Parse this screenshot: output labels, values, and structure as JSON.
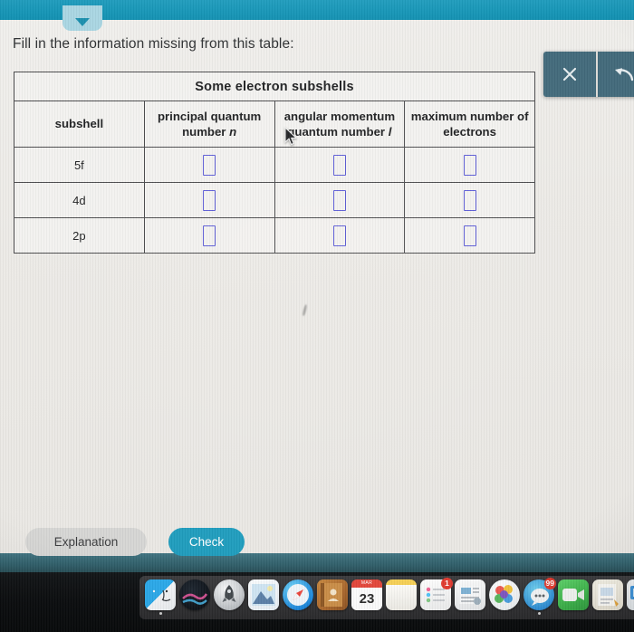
{
  "app": {
    "topbar_color": "#1595b6",
    "tab_icon": "chevron-down-icon"
  },
  "prompt": {
    "text": "Fill in the information missing from this table:"
  },
  "table": {
    "title": "Some electron subshells",
    "columns": [
      "subshell",
      "principal quantum number",
      "angular momentum quantum number",
      "maximum number of electrons"
    ],
    "column_header_lines": {
      "c1": "subshell",
      "c2_line1": "principal quantum",
      "c2_line2": "number",
      "c2_symbol": "n",
      "c3_line1": "angular momentum",
      "c3_line2": "quantum number",
      "c3_symbol": "l",
      "c4_line1": "maximum number of",
      "c4_line2": "electrons"
    },
    "rows": [
      {
        "subshell": "5f",
        "n": "",
        "l": "",
        "max_electrons": ""
      },
      {
        "subshell": "4d",
        "n": "",
        "l": "",
        "max_electrons": ""
      },
      {
        "subshell": "2p",
        "n": "",
        "l": "",
        "max_electrons": ""
      }
    ],
    "input_placeholder": "",
    "input_border_color": "#5a5ad6"
  },
  "float_tools": {
    "close_icon": "close-x-icon",
    "undo_icon": "undo-arrow-icon",
    "background_color": "#41697a"
  },
  "buttons": {
    "explanation": "Explanation",
    "check": "Check",
    "check_color": "#1e9cbd",
    "explanation_color": "#d6d6d4"
  },
  "dock": {
    "items": [
      {
        "name": "finder",
        "badge": "",
        "running": true
      },
      {
        "name": "siri",
        "badge": "",
        "running": false
      },
      {
        "name": "launchpad",
        "badge": "",
        "running": false
      },
      {
        "name": "photos",
        "badge": "",
        "running": false
      },
      {
        "name": "safari",
        "badge": "",
        "running": false
      },
      {
        "name": "contacts",
        "badge": "",
        "running": false
      },
      {
        "name": "calendar",
        "badge": "",
        "running": false,
        "day": "23",
        "month": "MAR"
      },
      {
        "name": "notes",
        "badge": "",
        "running": false
      },
      {
        "name": "reminders",
        "badge": "1",
        "running": false
      },
      {
        "name": "news",
        "badge": "",
        "running": false
      },
      {
        "name": "app-store",
        "badge": "",
        "running": false
      },
      {
        "name": "messages",
        "badge": "99",
        "running": true
      },
      {
        "name": "facetime",
        "badge": "",
        "running": false
      },
      {
        "name": "pages",
        "badge": "",
        "running": false
      },
      {
        "name": "keynote",
        "badge": "",
        "running": false
      }
    ]
  }
}
